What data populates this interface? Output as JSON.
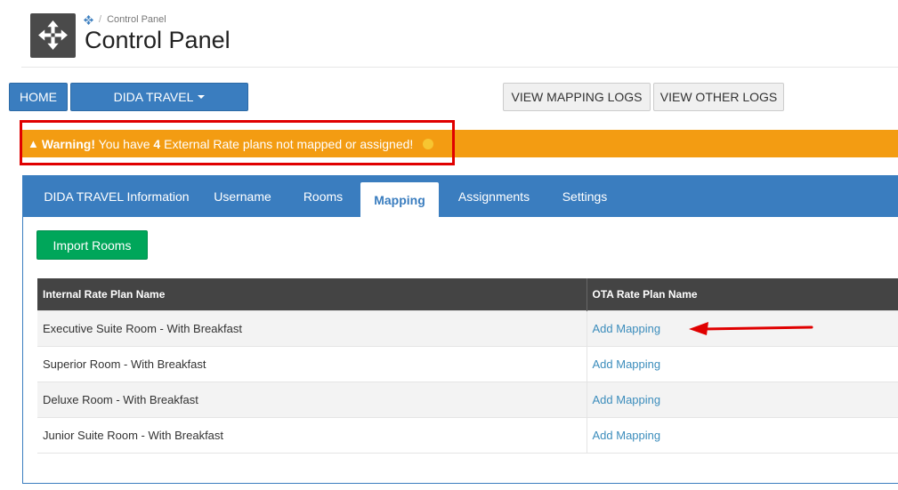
{
  "header": {
    "breadcrumb": "Control Panel",
    "title": "Control Panel"
  },
  "toolbar": {
    "home_label": "HOME",
    "channel_label": "DIDA TRAVEL",
    "view_mapping_logs": "VIEW MAPPING LOGS",
    "view_other_logs": "VIEW OTHER LOGS"
  },
  "warning": {
    "strong": "Warning!",
    "text_before": " You have ",
    "count": "4",
    "text_after": " External Rate plans not mapped or assigned!"
  },
  "tabs": [
    {
      "label": "DIDA TRAVEL Information"
    },
    {
      "label": "Username"
    },
    {
      "label": "Rooms"
    },
    {
      "label": "Mapping",
      "active": true
    },
    {
      "label": "Assignments"
    },
    {
      "label": "Settings"
    }
  ],
  "import_button": "Import Rooms",
  "table": {
    "headers": [
      "Internal Rate Plan Name",
      "OTA Rate Plan Name"
    ],
    "rows": [
      {
        "name": "Executive Suite Room - With Breakfast",
        "action": "Add Mapping"
      },
      {
        "name": "Superior Room - With Breakfast",
        "action": "Add Mapping"
      },
      {
        "name": "Deluxe Room - With Breakfast",
        "action": "Add Mapping"
      },
      {
        "name": "Junior Suite Room - With Breakfast",
        "action": "Add Mapping"
      }
    ]
  },
  "colors": {
    "primary": "#3a7dbf",
    "warning": "#f39c12",
    "success": "#00a65a",
    "annotation": "#e00000"
  }
}
